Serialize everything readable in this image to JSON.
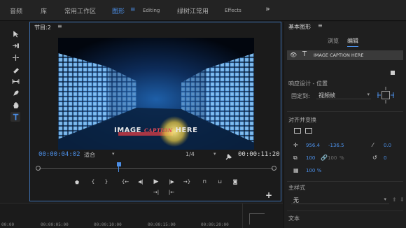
{
  "workspaces": [
    {
      "label": "音频",
      "active": false
    },
    {
      "label": "库",
      "active": false
    },
    {
      "label": "常用工作区",
      "active": false
    },
    {
      "label": "图形",
      "active": true
    },
    {
      "label": "Editing",
      "active": false
    },
    {
      "label": "绿树江常用",
      "active": false
    },
    {
      "label": "Effects",
      "active": false
    }
  ],
  "workspace_menu_icon": "≡",
  "workspace_overflow_icon": "»",
  "tools": [
    "selection-tool-icon",
    "track-select-icon",
    "ripple-edit-icon",
    "razor-icon",
    "slip-icon",
    "pen-icon",
    "hand-icon",
    "type-tool-icon"
  ],
  "monitor": {
    "title": "节目:2",
    "menu_icon": "≡",
    "caption": {
      "left": "IMAGE ",
      "mid": "CAPTION",
      "right": " HERE"
    },
    "timecode_current": "00:00:04:02",
    "fit_label": "适合",
    "quality_label": "1/4",
    "timecode_duration": "00:00:11:20",
    "playhead_fraction": 0.34
  },
  "timeline": {
    "times": [
      "00:00",
      "00:00:05:00",
      "00:00:10:00",
      "00:00:15:00",
      "00:00:20:00"
    ]
  },
  "essential_graphics": {
    "title": "基本图形",
    "menu_icon": "≡",
    "tab_browse": "浏览",
    "tab_edit": "编辑",
    "layer_name": "IMAGE CAPTION HERE",
    "responsive_label": "响应设计 - 位置",
    "fixed_to_label": "固定到:",
    "fixed_to_value": "视频帧",
    "align_label": "对齐并变换",
    "pos_x": "956.4",
    "pos_y": "-136.5",
    "rotation_label": "0.0",
    "scale_w": "100",
    "scale_h": "100",
    "scale_unit": "%",
    "anchor_label": "0",
    "opacity": "100 %",
    "master_style_label": "主样式",
    "master_style_value": "无",
    "text_label": "文本"
  },
  "colors": {
    "accent": "#4b8ee6",
    "caption_mid": "#e74b56"
  }
}
